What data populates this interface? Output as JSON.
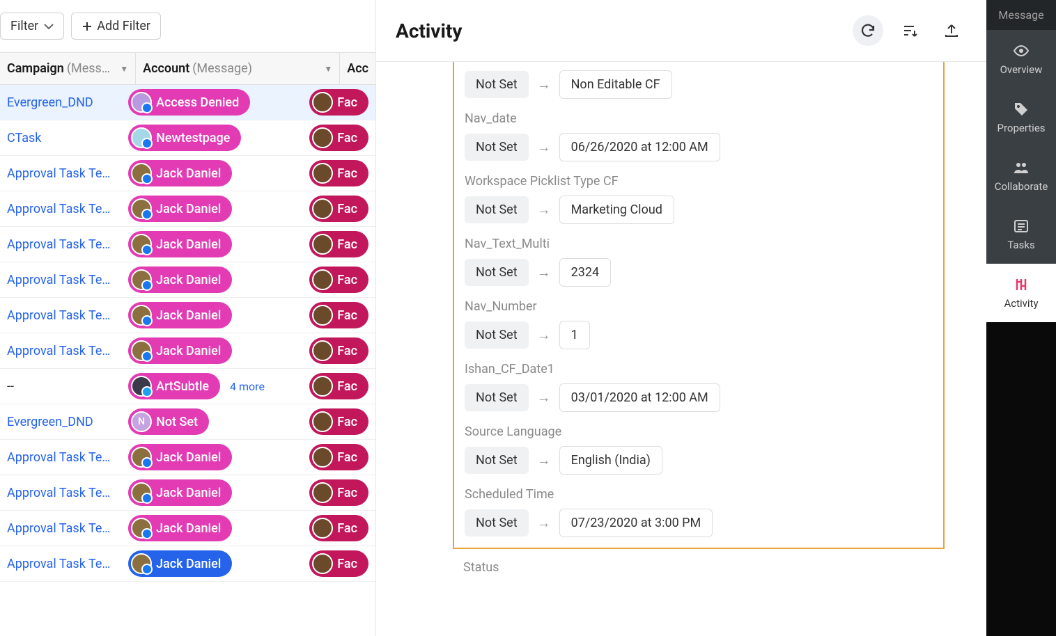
{
  "filterBar": {
    "filterLabel": "Filter",
    "addFilterLabel": "Add Filter"
  },
  "columns": {
    "campaign": {
      "label": "Campaign",
      "sub": "(Mess…"
    },
    "account": {
      "label": "Account",
      "sub": "(Message)"
    },
    "acc2": {
      "label": "Acc"
    }
  },
  "rows": [
    {
      "campaign": "Evergreen_DND",
      "account": "Access Denied",
      "avatar": "ad",
      "badge": "fb",
      "acc2": "Fac",
      "selected": true
    },
    {
      "campaign": "CTask",
      "account": "Newtestpage",
      "avatar": "nt",
      "badge": "fb",
      "acc2": "Fac"
    },
    {
      "campaign": "Approval Task Testw",
      "account": "Jack Daniel",
      "avatar": "jd",
      "badge": "fb",
      "acc2": "Fac"
    },
    {
      "campaign": "Approval Task Testw",
      "account": "Jack Daniel",
      "avatar": "jd",
      "badge": "fb",
      "acc2": "Fac"
    },
    {
      "campaign": "Approval Task Testw",
      "account": "Jack Daniel",
      "avatar": "jd",
      "badge": "fb",
      "acc2": "Fac"
    },
    {
      "campaign": "Approval Task Testw",
      "account": "Jack Daniel",
      "avatar": "jd",
      "badge": "fb",
      "acc2": "Fac"
    },
    {
      "campaign": "Approval Task Testw",
      "account": "Jack Daniel",
      "avatar": "jd",
      "badge": "fb",
      "acc2": "Fac"
    },
    {
      "campaign": "Approval Task Testw",
      "account": "Jack Daniel",
      "avatar": "jd",
      "badge": "fb",
      "acc2": "Fac"
    },
    {
      "campaign": "--",
      "account": "ArtSubtle",
      "avatar": "as",
      "badge": "tw",
      "acc2": "Fac",
      "more": "4 more"
    },
    {
      "campaign": "Evergreen_DND",
      "account": "Not Set",
      "avatar": "ns",
      "badge": "",
      "acc2": "Fac",
      "pill": "notset"
    },
    {
      "campaign": "Approval Task Testw",
      "account": "Jack Daniel",
      "avatar": "jd",
      "badge": "fb",
      "acc2": "Fac"
    },
    {
      "campaign": "Approval Task Testw",
      "account": "Jack Daniel",
      "avatar": "jd",
      "badge": "fb",
      "acc2": "Fac"
    },
    {
      "campaign": "Approval Task Testw",
      "account": "Jack Daniel",
      "avatar": "jd",
      "badge": "fb",
      "acc2": "Fac"
    },
    {
      "campaign": "Approval Task Testw",
      "account": "Jack Daniel",
      "avatar": "jd",
      "badge": "fb",
      "acc2": "Fac",
      "pill": "blue"
    }
  ],
  "activity": {
    "title": "Activity",
    "fields": [
      {
        "label": "",
        "from": "Not Set",
        "to": "Non Editable CF"
      },
      {
        "label": "Nav_date",
        "from": "Not Set",
        "to": "06/26/2020 at 12:00 AM"
      },
      {
        "label": "Workspace Picklist Type CF",
        "from": "Not Set",
        "to": "Marketing Cloud"
      },
      {
        "label": "Nav_Text_Multi",
        "from": "Not Set",
        "to": "2324"
      },
      {
        "label": "Nav_Number",
        "from": "Not Set",
        "to": "1"
      },
      {
        "label": "Ishan_CF_Date1",
        "from": "Not Set",
        "to": "03/01/2020 at 12:00 AM"
      },
      {
        "label": "Source Language",
        "from": "Not Set",
        "to": "English (India)"
      },
      {
        "label": "Scheduled Time",
        "from": "Not Set",
        "to": "07/23/2020 at 3:00 PM"
      }
    ],
    "statusBelow": "Status"
  },
  "rail": {
    "top": "Message",
    "items": [
      {
        "label": "Overview",
        "icon": "eye"
      },
      {
        "label": "Properties",
        "icon": "tag"
      },
      {
        "label": "Collaborate",
        "icon": "people"
      },
      {
        "label": "Tasks",
        "icon": "list"
      },
      {
        "label": "Activity",
        "icon": "activity",
        "active": true
      }
    ]
  }
}
